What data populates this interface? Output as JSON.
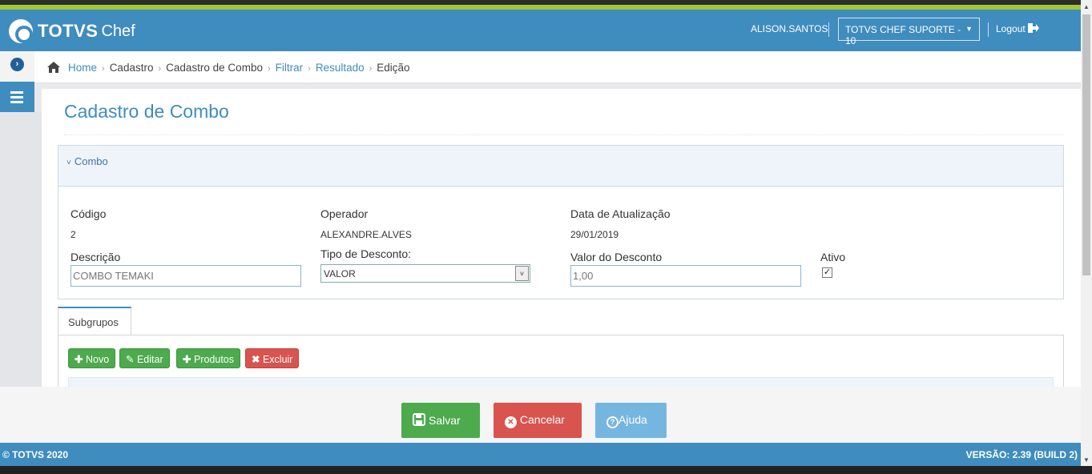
{
  "header": {
    "logo_bold": "TOTVS",
    "logo_light": "Chef",
    "user": "ALISON.SANTOS",
    "tenant": "TOTVS CHEF SUPORTE - 10",
    "logout": "Logout"
  },
  "breadcrumb": {
    "home": "Home",
    "cadastro": "Cadastro",
    "cadastro_combo": "Cadastro de Combo",
    "filtrar": "Filtrar",
    "resultado": "Resultado",
    "edicao": "Edição"
  },
  "page": {
    "title": "Cadastro de Combo"
  },
  "panel": {
    "title": "Combo",
    "codigo_label": "Código",
    "codigo_value": "2",
    "operador_label": "Operador",
    "operador_value": "ALEXANDRE.ALVES",
    "data_label": "Data de Atualização",
    "data_value": "29/01/2019",
    "descricao_label": "Descrição",
    "descricao_value": "COMBO TEMAKI",
    "tipo_label": "Tipo de Desconto:",
    "tipo_value": "VALOR",
    "valor_label": "Valor do Desconto",
    "valor_value": "1,00",
    "ativo_label": "Ativo",
    "ativo_checked": true
  },
  "subgrupos": {
    "tab_label": "Subgrupos",
    "novo": "Novo",
    "editar": "Editar",
    "produtos": "Produtos",
    "excluir": "Excluir"
  },
  "actions": {
    "save": "Salvar",
    "cancel": "Cancelar",
    "help": "Ajuda"
  },
  "footer": {
    "copyright": "© TOTVS 2020",
    "version": "VERSÃO: 2.39 (BUILD 2)"
  },
  "colors": {
    "primary": "#3f8cbf",
    "success": "#4daa4d",
    "danger": "#d9534f",
    "info": "#74b6e0",
    "lime": "#a4c639"
  }
}
